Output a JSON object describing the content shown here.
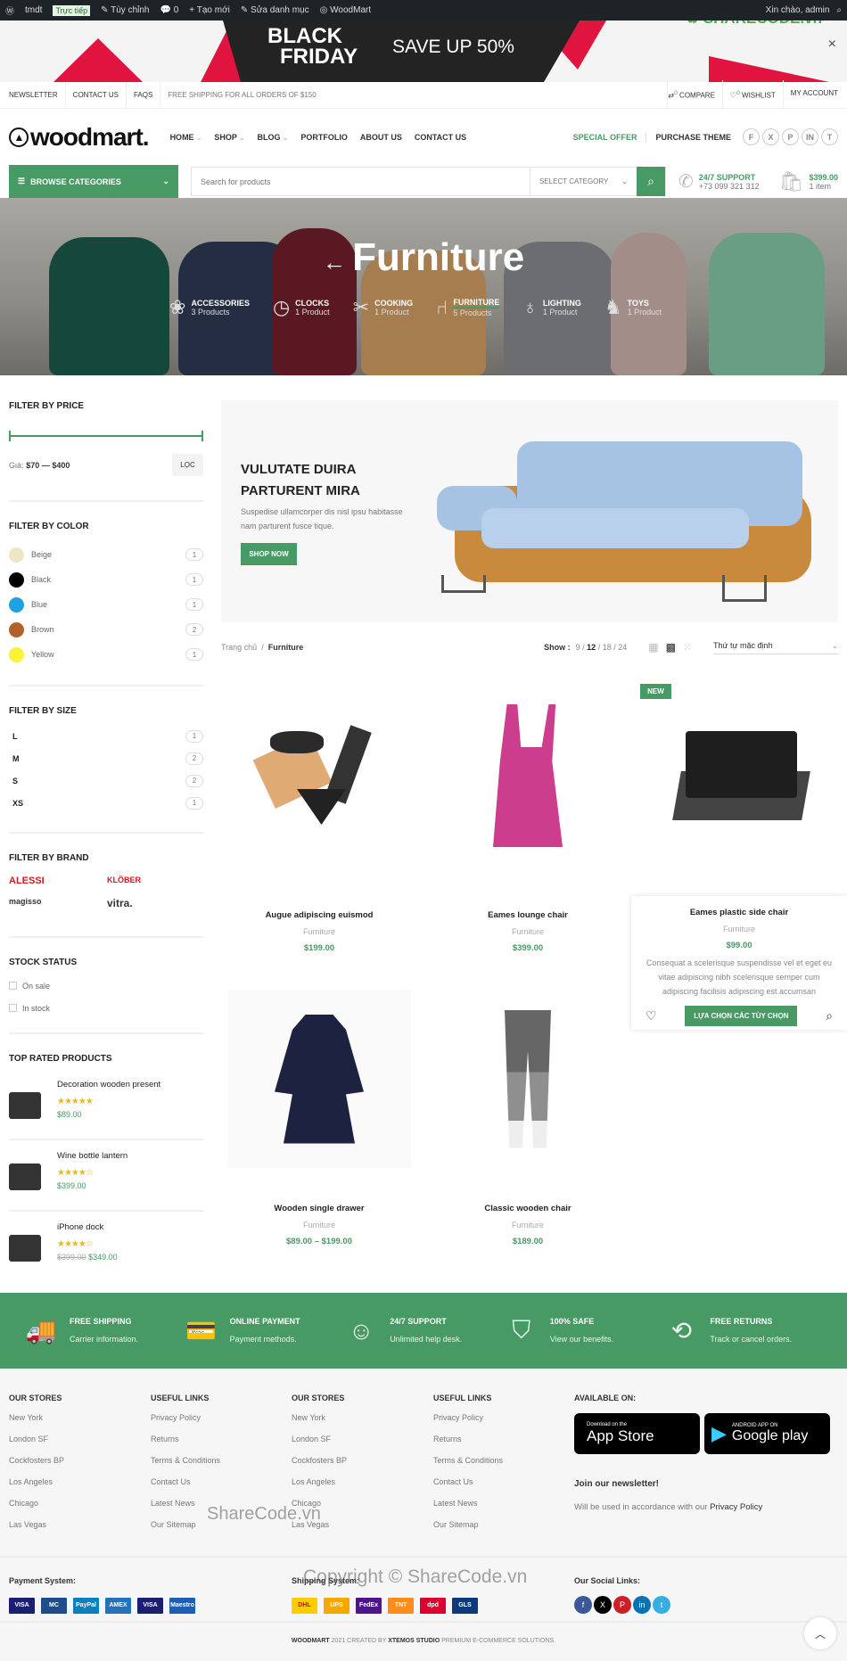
{
  "admin_bar": {
    "site": "tmdt",
    "live": "Trực tiếp",
    "customize": "Tùy chỉnh",
    "comments": "0",
    "new": "Tạo mới",
    "edit": "Sửa danh mục",
    "theme": "WoodMart",
    "greeting": "Xin chào, admin"
  },
  "promo_banner": {
    "line1": "BLACK",
    "line2": "FRIDAY",
    "offer": "SAVE UP 50%",
    "close": "×"
  },
  "topbar": {
    "left": [
      "NEWSLETTER",
      "CONTACT US",
      "FAQS"
    ],
    "shipping": "FREE SHIPPING FOR ALL ORDERS OF $150",
    "compare": "COMPARE",
    "compare_count": "0",
    "wishlist": "WISHLIST",
    "wishlist_count": "0",
    "account": "MY ACCOUNT"
  },
  "header": {
    "logo": "woodmart.",
    "nav": [
      "HOME",
      "SHOP",
      "BLOG",
      "PORTFOLIO",
      "ABOUT US",
      "CONTACT US"
    ],
    "special_offer": "SPECIAL OFFER",
    "purchase": "PURCHASE THEME",
    "social": [
      "f",
      "X",
      "P",
      "in",
      "t"
    ]
  },
  "search": {
    "browse": "BROWSE CATEGORIES",
    "placeholder": "Search for products",
    "category": "SELECT CATEGORY",
    "support_title": "24/7 SUPPORT",
    "support_phone": "+73 099 321 312",
    "cart_total": "$399.00",
    "cart_items": "1 item"
  },
  "hero": {
    "title": "Furniture",
    "categories": [
      {
        "name": "ACCESSORIES",
        "count": "3 Products",
        "icon": "plant-icon"
      },
      {
        "name": "CLOCKS",
        "count": "1 Product",
        "icon": "clock-icon"
      },
      {
        "name": "COOKING",
        "count": "1 Product",
        "icon": "knife-block-icon"
      },
      {
        "name": "FURNITURE",
        "count": "5 Products",
        "icon": "chair-icon"
      },
      {
        "name": "LIGHTING",
        "count": "1 Product",
        "icon": "bulb-icon"
      },
      {
        "name": "TOYS",
        "count": "1 Product",
        "icon": "rocking-horse-icon"
      }
    ]
  },
  "sidebar": {
    "price": {
      "title": "FILTER BY PRICE",
      "label": "Giá:",
      "range": "$70 — $400",
      "button": "LỌC"
    },
    "color": {
      "title": "FILTER BY COLOR",
      "items": [
        {
          "name": "Beige",
          "count": "1",
          "color": "#efe6c7"
        },
        {
          "name": "Black",
          "count": "1",
          "color": "#000000"
        },
        {
          "name": "Blue",
          "count": "1",
          "color": "#1ea2e3"
        },
        {
          "name": "Brown",
          "count": "2",
          "color": "#b0622a"
        },
        {
          "name": "Yellow",
          "count": "1",
          "color": "#f8f337"
        }
      ]
    },
    "size": {
      "title": "FILTER BY SIZE",
      "items": [
        {
          "name": "L",
          "count": "1"
        },
        {
          "name": "M",
          "count": "2"
        },
        {
          "name": "S",
          "count": "2"
        },
        {
          "name": "XS",
          "count": "1"
        }
      ]
    },
    "brand": {
      "title": "FILTER BY BRAND",
      "items": [
        "ALESSI",
        "KLÖBER",
        "magisso",
        "vitra."
      ]
    },
    "stock": {
      "title": "STOCK STATUS",
      "items": [
        "On sale",
        "In stock"
      ]
    },
    "top_rated": {
      "title": "TOP RATED PRODUCTS",
      "items": [
        {
          "name": "Decoration wooden present",
          "rating": 5,
          "stars": "★★★★★",
          "price": "$89.00",
          "old_price": ""
        },
        {
          "name": "Wine bottle lantern",
          "rating": 4,
          "stars": "★★★★☆",
          "price": "$399.00",
          "old_price": ""
        },
        {
          "name": "iPhone dock",
          "rating": 4,
          "stars": "★★★★☆",
          "price": "$349.00",
          "old_price": "$399.00"
        }
      ]
    }
  },
  "promo": {
    "title1": "VULUTATE DUIRA",
    "title2": "PARTURENT MIRA",
    "text": "Suspedise ullamcorper dis nisl ipsu habitasse nam parturent fusce tique.",
    "button": "SHOP NOW"
  },
  "toolbar": {
    "breadcrumb_home": "Trang chủ",
    "breadcrumb_sep": "/",
    "breadcrumb_current": "Furniture",
    "show_label": "Show :",
    "show_options": [
      "9",
      "12",
      "18",
      "24"
    ],
    "show_active": "12",
    "sort": "Thứ tự mặc định"
  },
  "products": [
    {
      "name": "Augue adipiscing euismod",
      "category": "Furniture",
      "price": "$199.00"
    },
    {
      "name": "Eames lounge chair",
      "category": "Furniture",
      "price": "$399.00"
    },
    {
      "name": "Eames plastic side chair",
      "category": "Furniture",
      "price": "$99.00",
      "badge": "NEW",
      "description": "Consequat a scelerisque suspendisse vel et eget eu vitae adipiscing nibh scelerisque semper cum adipiscing facilisis adipiscing est accumsan",
      "button": "LỰA CHỌN CÁC TÙY CHỌN"
    },
    {
      "name": "Wooden single drawer",
      "category": "Furniture",
      "price": "$89.00 – $199.00"
    },
    {
      "name": "Classic wooden chair",
      "category": "Furniture",
      "price": "$189.00"
    }
  ],
  "features": [
    {
      "title": "FREE SHIPPING",
      "text": "Carrier information.",
      "icon": "truck-icon"
    },
    {
      "title": "ONLINE PAYMENT",
      "text": "Payment methods.",
      "icon": "card-icon"
    },
    {
      "title": "24/7 SUPPORT",
      "text": "Unlimited help desk.",
      "icon": "support-agent-icon"
    },
    {
      "title": "100% SAFE",
      "text": "View our benefits.",
      "icon": "shield-check-icon"
    },
    {
      "title": "FREE RETURNS",
      "text": "Track or cancel orders.",
      "icon": "box-return-icon"
    }
  ],
  "footer": {
    "columns": [
      {
        "title": "OUR STORES",
        "links": [
          "New York",
          "London SF",
          "Cockfosters BP",
          "Los Angeles",
          "Chicago",
          "Las Vegas"
        ]
      },
      {
        "title": "USEFUL LINKS",
        "links": [
          "Privacy Policy",
          "Returns",
          "Terms & Conditions",
          "Contact Us",
          "Latest News",
          "Our Sitemap"
        ]
      },
      {
        "title": "OUR STORES",
        "links": [
          "New York",
          "London SF",
          "Cockfosters BP",
          "Los Angeles",
          "Chicago",
          "Las Vegas"
        ]
      },
      {
        "title": "USEFUL LINKS",
        "links": [
          "Privacy Policy",
          "Returns",
          "Terms & Conditions",
          "Contact Us",
          "Latest News",
          "Our Sitemap"
        ]
      }
    ],
    "available": "AVAILABLE ON:",
    "appstore_small": "Download on the",
    "appstore": "App Store",
    "googleplay_small": "ANDROID APP ON",
    "googleplay": "Google play",
    "newsletter_title": "Join our newsletter!",
    "newsletter_text": "Will be used in accordance with our",
    "newsletter_link": "Privacy Policy",
    "payment_title": "Payment System:",
    "payments": [
      "VISA",
      "MC",
      "PayPal",
      "AMEX",
      "VISA",
      "Maestro"
    ],
    "shipping_title": "Shipping System:",
    "shipping": [
      "DHL",
      "UPS",
      "FedEx",
      "TNT",
      "dpd",
      "GLS"
    ],
    "social_title": "Our Social Links:",
    "social": [
      "f",
      "X",
      "P",
      "in",
      "t"
    ],
    "copyright_brand": "WOODMART",
    "copyright_mid": "2021 CREATED BY",
    "copyright_studio": "XTEMOS STUDIO",
    "copyright_end": "PREMIUM E-COMMERCE SOLUTIONS.",
    "watermark1": "ShareCode.vn",
    "watermark2": "Copyright © ShareCode.vn"
  },
  "colors": {
    "accent": "#479a63",
    "dark": "#232323",
    "sale": "#e11d48"
  }
}
